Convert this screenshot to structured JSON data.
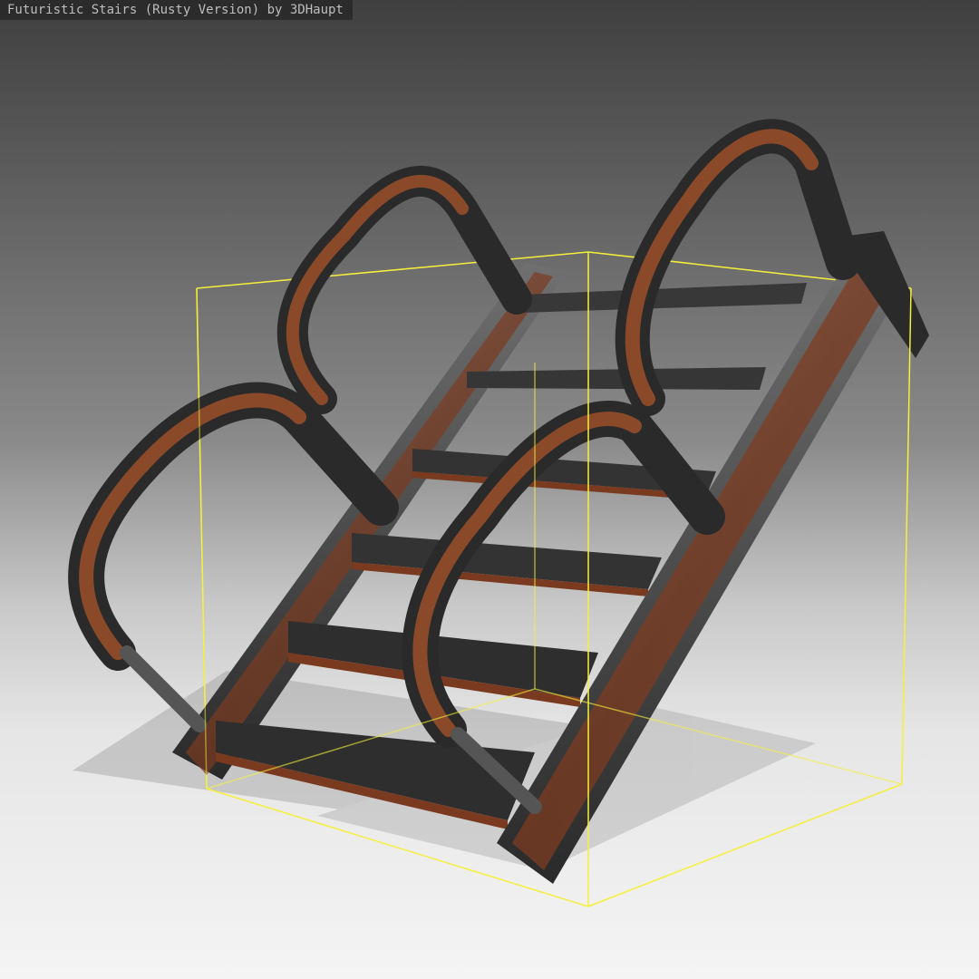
{
  "viewer": {
    "title": "Futuristic Stairs (Rusty Version) by 3DHaupt"
  },
  "colors": {
    "background_top": "#3f3f3f",
    "background_bottom": "#f4f4f4",
    "bounding_box": "#f5f03c",
    "metal_dark": "#2b2b2b",
    "metal_light": "#6a6a6a",
    "rust": "#a0522d"
  },
  "scene": {
    "object": "stairs-model",
    "step_count": 6,
    "handrail_count": 4
  }
}
